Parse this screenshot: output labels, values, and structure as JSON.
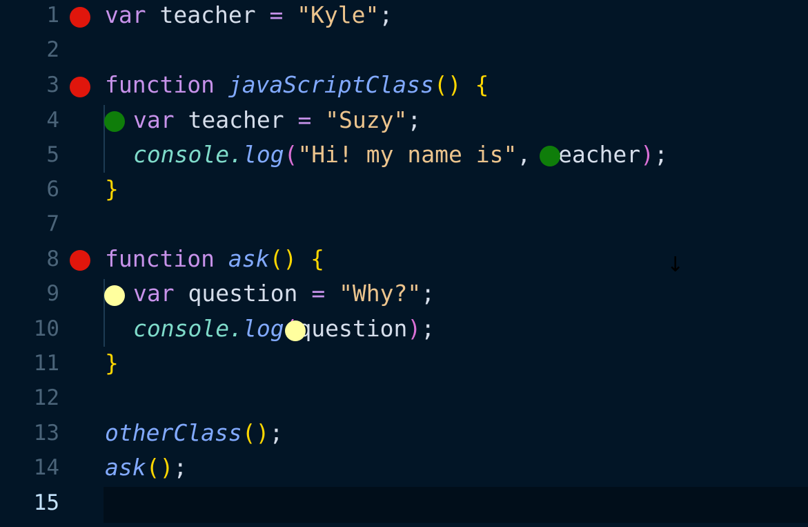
{
  "editor": {
    "language": "javascript",
    "active_line": 15,
    "colors": {
      "background": "#021526",
      "breakpoint_red": "#e0160c",
      "breakpoint_green": "#0f7d0a",
      "breakpoint_yellow": "#ffff9e"
    },
    "line_numbers": [
      "1",
      "2",
      "3",
      "4",
      "5",
      "6",
      "7",
      "8",
      "9",
      "10",
      "11",
      "12",
      "13",
      "14",
      "15"
    ],
    "tokens": {
      "l1_kw": "var",
      "l1_id": "teacher",
      "l1_op": "=",
      "l1_str": "\"Kyle\"",
      "l1_end": ";",
      "l3_kw": "function",
      "l3_fn": "javaScriptClass",
      "l3_paren": "()",
      "l3_brace": "{",
      "l4_kw": "var",
      "l4_id": "teacher",
      "l4_op": "=",
      "l4_str": "\"Suzy\"",
      "l4_end": ";",
      "l5_obj": "console",
      "l5_dot": ".",
      "l5_meth": "log",
      "l5_open": "(",
      "l5_str": "\"Hi! my name is\"",
      "l5_comma": ",",
      "l5_arg": "teacher",
      "l5_close": ")",
      "l5_end": ";",
      "l6_brace": "}",
      "l8_kw": "function",
      "l8_fn": "ask",
      "l8_paren": "()",
      "l8_brace": "{",
      "l9_kw": "var",
      "l9_id": "question",
      "l9_op": "=",
      "l9_str": "\"Why?\"",
      "l9_end": ";",
      "l10_obj": "console",
      "l10_dot": ".",
      "l10_meth": "log",
      "l10_open": "(",
      "l10_arg": "question",
      "l10_close": ")",
      "l10_end": ";",
      "l11_brace": "}",
      "l13_fn": "otherClass",
      "l13_paren": "()",
      "l13_end": ";",
      "l14_fn": "ask",
      "l14_paren": "()",
      "l14_end": ";"
    },
    "breakpoints": [
      {
        "line": 1,
        "color": "red"
      },
      {
        "line": 3,
        "color": "red"
      },
      {
        "line": 4,
        "color": "green"
      },
      {
        "line": 5,
        "color": "green"
      },
      {
        "line": 8,
        "color": "red"
      },
      {
        "line": 9,
        "color": "yellow"
      },
      {
        "line": 10,
        "color": "yellow"
      }
    ],
    "mouse_cursor_glyph": "↓"
  }
}
